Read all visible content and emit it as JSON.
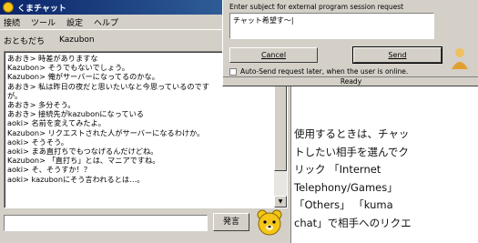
{
  "chat_window": {
    "title": "くまチャット",
    "menu": [
      "接続",
      "ツール",
      "設定",
      "ヘルプ"
    ],
    "buddy_label": "おともだち",
    "buddy_name": "Kazubon",
    "log": [
      "あおき> 時差がありますな",
      "Kazubon> そうでもないでしょう。",
      "Kazubon> 俺がサーバーになってるのかな。",
      "あおき> 私は昨日の夜だと思いたいなと今思っているのです",
      "が。",
      "あおき> 多分そう。",
      "あおき> 接続先がkazubonになっている",
      "aoki> 名前を変えてみたよ。",
      "Kazubon> リクエストされた人がサーバーになるわけか。",
      "aoki> そうそう。",
      "aoki> まあ直打ちでもつなげるんだけどね。",
      "Kazubon> 「直打ち」とは、マニアですね。",
      "aoki> そ、そうすか！？",
      "aoki> kazubonにそう言われるとは…。"
    ],
    "input_value": "",
    "send_label": "発言",
    "scroll_up": "▲",
    "scroll_down": "▼"
  },
  "dialog": {
    "prompt": "Enter subject for external program session request",
    "subject_value": "チャット希望す〜|",
    "cancel_label": "Cancel",
    "send_label": "Send",
    "auto_send_label": "Auto-Send request later, when the user is online.",
    "auto_send_checked": false,
    "status": "Ready"
  },
  "article": {
    "lines": [
      "使用するときは、チャッ",
      "トしたい相手を選んでク",
      "リック 「Internet",
      "Telephony/Games」",
      "「Others」 「kuma",
      "chat」で相手へのリクエ"
    ]
  },
  "colors": {
    "titlebar_start": "#0a246a",
    "titlebar_end": "#3a6ea5",
    "window_face": "#d4d0c8",
    "bear_fill": "#f5c518"
  }
}
